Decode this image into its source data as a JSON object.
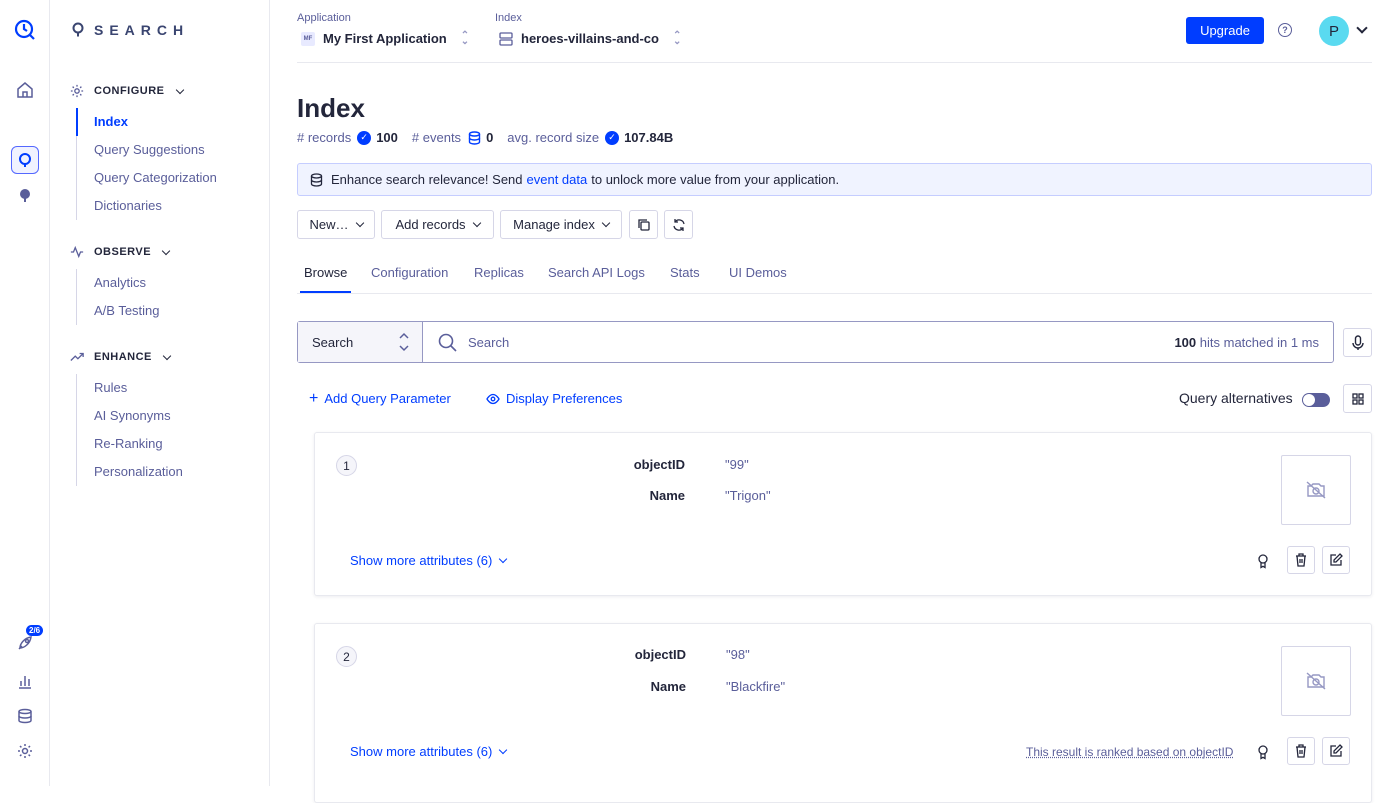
{
  "rail": {
    "badge": "2/6"
  },
  "sidebar": {
    "logo_text": "SEARCH",
    "sections": [
      {
        "title": "CONFIGURE",
        "items": [
          "Index",
          "Query Suggestions",
          "Query Categorization",
          "Dictionaries"
        ]
      },
      {
        "title": "OBSERVE",
        "items": [
          "Analytics",
          "A/B Testing"
        ]
      },
      {
        "title": "ENHANCE",
        "items": [
          "Rules",
          "AI Synonyms",
          "Re-Ranking",
          "Personalization"
        ]
      }
    ]
  },
  "topbar": {
    "application_label": "Application",
    "application_abbr": "MF",
    "application_value": "My First Application",
    "index_label": "Index",
    "index_value": "heroes-villains-and-co",
    "upgrade": "Upgrade",
    "help": "?",
    "avatar_initial": "P"
  },
  "page": {
    "title": "Index",
    "records_label": "# records",
    "records_value": "100",
    "events_label": "# events",
    "events_value": "0",
    "avg_label": "avg. record size",
    "avg_value": "107.84B"
  },
  "banner": {
    "prefix": "Enhance search relevance! Send",
    "link": "event data",
    "suffix": "to unlock more value from your application."
  },
  "toolbar": {
    "new": "New…",
    "add_records": "Add records",
    "manage_index": "Manage index"
  },
  "tabs": [
    "Browse",
    "Configuration",
    "Replicas",
    "Search API Logs",
    "Stats",
    "UI Demos"
  ],
  "search": {
    "mode": "Search",
    "placeholder": "Search",
    "hits_count": "100",
    "hits_text": "hits matched in 1 ms"
  },
  "query": {
    "add_param": "Add Query Parameter",
    "display_prefs": "Display Preferences",
    "alternatives": "Query alternatives",
    "alternatives_enabled": false
  },
  "hits": [
    {
      "num": "1",
      "objectID_key": "objectID",
      "objectID": "\"99\"",
      "name_key": "Name",
      "name": "\"Trigon\"",
      "show_more": "Show more attributes (6)",
      "ranked_note": ""
    },
    {
      "num": "2",
      "objectID_key": "objectID",
      "objectID": "\"98\"",
      "name_key": "Name",
      "name": "\"Blackfire\"",
      "show_more": "Show more attributes (6)",
      "ranked_note": "This result is ranked based on objectID"
    }
  ]
}
